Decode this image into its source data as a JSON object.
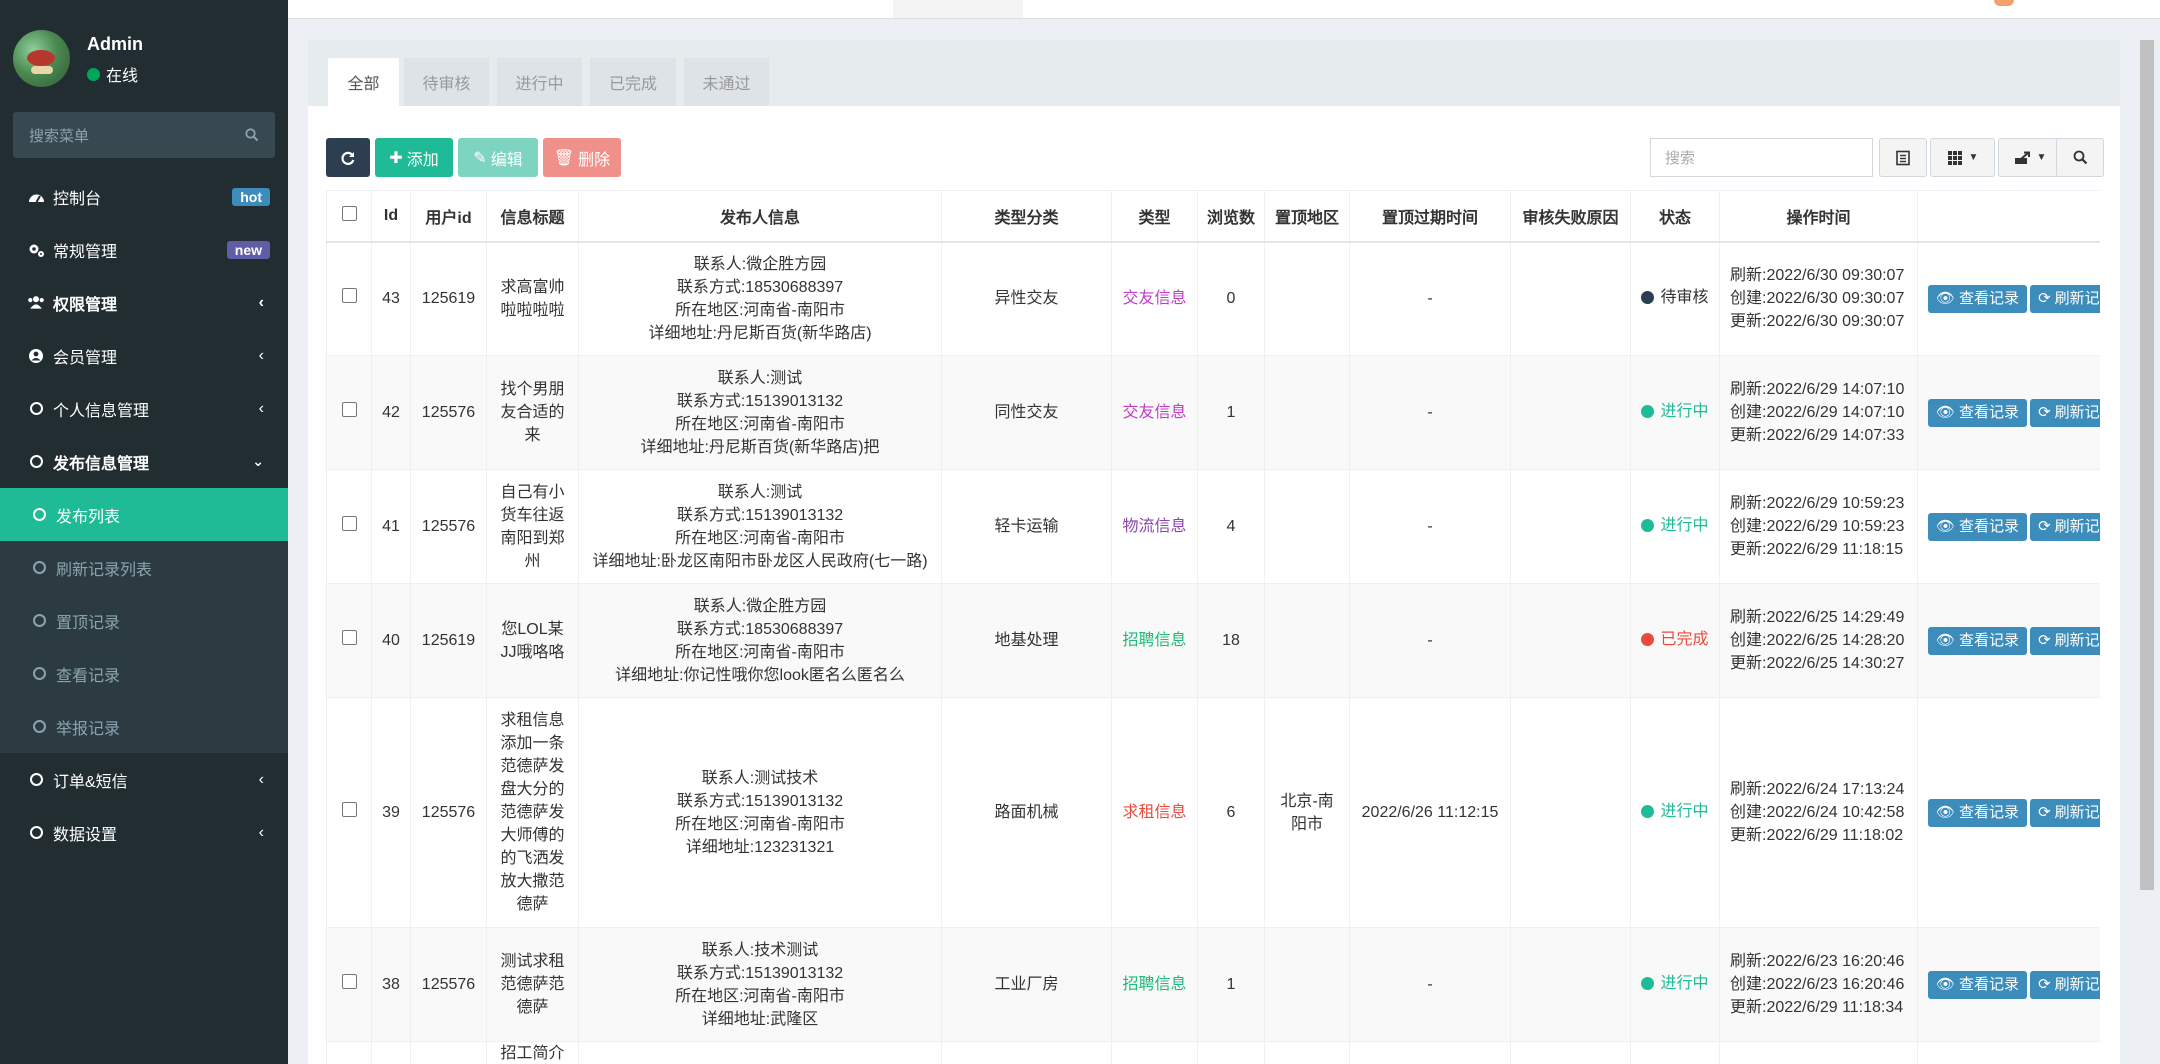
{
  "sidebar": {
    "user": {
      "name": "Admin",
      "status": "在线"
    },
    "search_placeholder": "搜索菜单",
    "menu": [
      {
        "label": "控制台",
        "icon": "dashboard-icon",
        "badge": "hot"
      },
      {
        "label": "常规管理",
        "icon": "cogs-icon",
        "badge": "new"
      },
      {
        "label": "权限管理",
        "icon": "group-icon"
      },
      {
        "label": "会员管理",
        "icon": "user-circle-icon"
      },
      {
        "label": "个人信息管理",
        "icon": "circle-icon"
      },
      {
        "label": "发布信息管理",
        "icon": "circle-icon"
      }
    ],
    "submenu": [
      {
        "label": "发布列表"
      },
      {
        "label": "刷新记录列表"
      },
      {
        "label": "置顶记录"
      },
      {
        "label": "查看记录"
      },
      {
        "label": "举报记录"
      }
    ],
    "menu_after": [
      {
        "label": "订单&短信"
      },
      {
        "label": "数据设置"
      }
    ]
  },
  "tabs": [
    "全部",
    "待审核",
    "进行中",
    "已完成",
    "未通过"
  ],
  "toolbar": {
    "add": "添加",
    "edit": "编辑",
    "delete": "删除"
  },
  "search": {
    "placeholder": "搜索"
  },
  "table": {
    "headers": [
      "Id",
      "用户id",
      "信息标题",
      "发布人信息",
      "类型分类",
      "类型",
      "浏览数",
      "置顶地区",
      "置顶过期时间",
      "审核失败原因",
      "状态",
      "操作时间"
    ],
    "view_label": "查看记录",
    "refresh_label": "刷新记录",
    "rows": [
      {
        "id": "43",
        "uid": "125619",
        "title": "求高富帅啦啦啦啦",
        "pub": [
          "联系人:微企胜方园",
          "联系方式:18530688397",
          "所在地区:河南省-南阳市",
          "详细地址:丹尼斯百货(新华路店)"
        ],
        "cat": "异性交友",
        "type": "交友信息",
        "views": "0",
        "area": "",
        "expire": "-",
        "reason": "",
        "status": "待审核",
        "times": [
          "刷新:2022/6/30 09:30:07",
          "创建:2022/6/30 09:30:07",
          "更新:2022/6/30 09:30:07"
        ]
      },
      {
        "id": "42",
        "uid": "125576",
        "title": "找个男朋友合适的来",
        "pub": [
          "联系人:测试",
          "联系方式:15139013132",
          "所在地区:河南省-南阳市",
          "详细地址:丹尼斯百货(新华路店)把"
        ],
        "cat": "同性交友",
        "type": "交友信息",
        "views": "1",
        "area": "",
        "expire": "-",
        "reason": "",
        "status": "进行中",
        "times": [
          "刷新:2022/6/29 14:07:10",
          "创建:2022/6/29 14:07:10",
          "更新:2022/6/29 14:07:33"
        ]
      },
      {
        "id": "41",
        "uid": "125576",
        "title": "自己有小货车往返南阳到郑州",
        "pub": [
          "联系人:测试",
          "联系方式:15139013132",
          "所在地区:河南省-南阳市",
          "详细地址:卧龙区南阳市卧龙区人民政府(七一路)"
        ],
        "cat": "轻卡运输",
        "type": "物流信息",
        "views": "4",
        "area": "",
        "expire": "-",
        "reason": "",
        "status": "进行中",
        "times": [
          "刷新:2022/6/29 10:59:23",
          "创建:2022/6/29 10:59:23",
          "更新:2022/6/29 11:18:15"
        ]
      },
      {
        "id": "40",
        "uid": "125619",
        "title": "您LOL某JJ哦咯咯",
        "pub": [
          "联系人:微企胜方园",
          "联系方式:18530688397",
          "所在地区:河南省-南阳市",
          "详细地址:你记性哦你您look匿名么匿名么"
        ],
        "cat": "地基处理",
        "type": "招聘信息",
        "views": "18",
        "area": "",
        "expire": "-",
        "reason": "",
        "status": "已完成",
        "times": [
          "刷新:2022/6/25 14:29:49",
          "创建:2022/6/25 14:28:20",
          "更新:2022/6/25 14:30:27"
        ]
      },
      {
        "id": "39",
        "uid": "125576",
        "title": "求租信息添加一条范德萨发盘大分的范德萨发大师傅的的飞洒发放大撒范德萨",
        "pub": [
          "联系人:测试技术",
          "联系方式:15139013132",
          "所在地区:河南省-南阳市",
          "详细地址:123231321"
        ],
        "cat": "路面机械",
        "type": "求租信息",
        "views": "6",
        "area": "北京-南阳市",
        "expire": "2022/6/26 11:12:15",
        "reason": "",
        "status": "进行中",
        "times": [
          "刷新:2022/6/24 17:13:24",
          "创建:2022/6/24 10:42:58",
          "更新:2022/6/29 11:18:02"
        ]
      },
      {
        "id": "38",
        "uid": "125576",
        "title": "测试求租范德萨范德萨",
        "pub": [
          "联系人:技术测试",
          "联系方式:15139013132",
          "所在地区:河南省-南阳市",
          "详细地址:武隆区"
        ],
        "cat": "工业厂房",
        "type": "招聘信息",
        "views": "1",
        "area": "",
        "expire": "-",
        "reason": "",
        "status": "进行中",
        "times": [
          "刷新:2022/6/23 16:20:46",
          "创建:2022/6/23 16:20:46",
          "更新:2022/6/29 11:18:34"
        ]
      },
      {
        "id": "",
        "uid": "",
        "title": "招工简介",
        "pub": [],
        "cat": "",
        "type": "",
        "views": "",
        "area": "",
        "expire": "",
        "reason": "",
        "status": "",
        "times": []
      }
    ]
  },
  "colors": {
    "sidebar_bg": "#222d32",
    "accent": "#1fbb97",
    "primary": "#3c8dbc",
    "danger": "#e74c3c"
  }
}
